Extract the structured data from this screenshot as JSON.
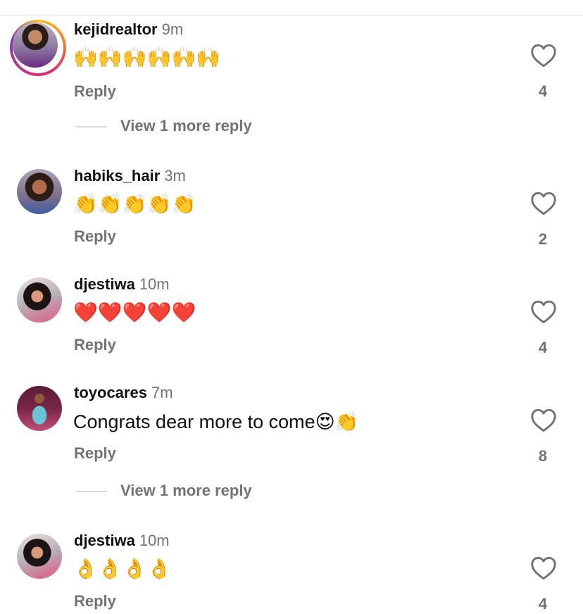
{
  "comments": [
    {
      "username": "kejidrealtor",
      "time": "9m",
      "text": "🙌🙌🙌🙌🙌🙌",
      "reply_label": "Reply",
      "likes": "4",
      "has_story_ring": true,
      "view_more": "View 1 more reply"
    },
    {
      "username": "habiks_hair",
      "time": "3m",
      "text": "👏👏👏👏👏",
      "reply_label": "Reply",
      "likes": "2",
      "has_story_ring": false
    },
    {
      "username": "djestiwa",
      "time": "10m",
      "text": "❤️❤️❤️❤️❤️",
      "reply_label": "Reply",
      "likes": "4",
      "has_story_ring": false
    },
    {
      "username": "toyocares",
      "time": "7m",
      "text": "Congrats dear more to come😍👏",
      "reply_label": "Reply",
      "likes": "8",
      "has_story_ring": false,
      "view_more": "View 1 more reply"
    },
    {
      "username": "djestiwa",
      "time": "10m",
      "text": "👌👌👌👌",
      "reply_label": "Reply",
      "likes": "4",
      "has_story_ring": false
    }
  ],
  "icons": {
    "like": "heart-outline-icon"
  },
  "colors": {
    "secondary_text": "#737373",
    "primary_text": "#111111",
    "divider": "#d9d9d9"
  }
}
